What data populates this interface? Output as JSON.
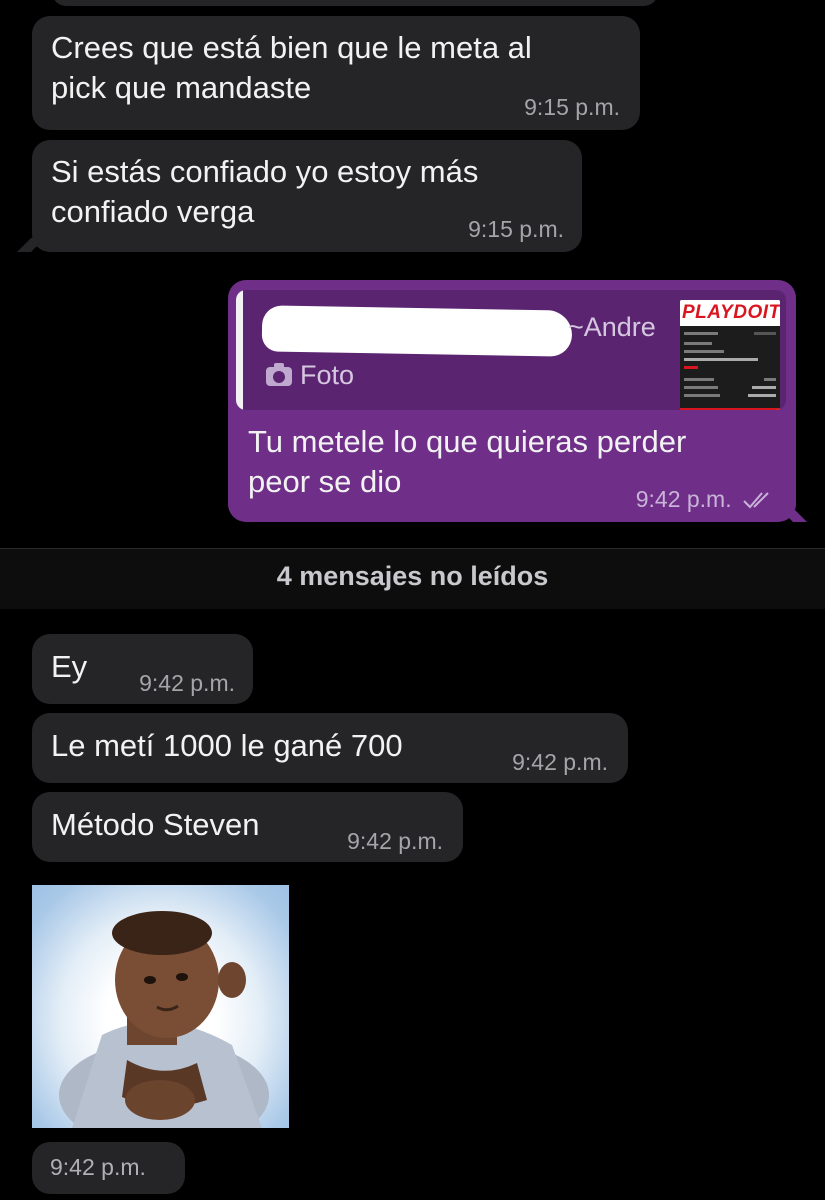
{
  "conversation": {
    "messages": [
      {
        "text": "Crees que está bien que le meta al\npick que mandaste",
        "time": "9:15 p.m."
      },
      {
        "text": "Si estás confiado yo estoy más\nconfiado verga",
        "time": "9:15 p.m."
      },
      {
        "text": "Tu metele lo que quieras perder\npeor se dio",
        "time": "9:42 p.m.",
        "quote": {
          "author": "~Andre",
          "media_label": "Foto",
          "thumbnail_brand": "PLAYDOIT"
        }
      },
      {
        "text": "Ey",
        "time": "9:42 p.m."
      },
      {
        "text": "Le metí 1000 le gané 700",
        "time": "9:42 p.m."
      },
      {
        "text": "Método Steven",
        "time": "9:42 p.m."
      },
      {
        "time": "9:42 p.m."
      }
    ],
    "unread_banner": "4 mensajes no leídos"
  },
  "colors": {
    "background": "#000000",
    "incoming_bubble": "#252527",
    "outgoing_bubble": "#6f2f88",
    "quote_background": "#5b2471"
  },
  "icons": {
    "camera": "camera-icon",
    "read_receipt": "double-check-icon"
  }
}
